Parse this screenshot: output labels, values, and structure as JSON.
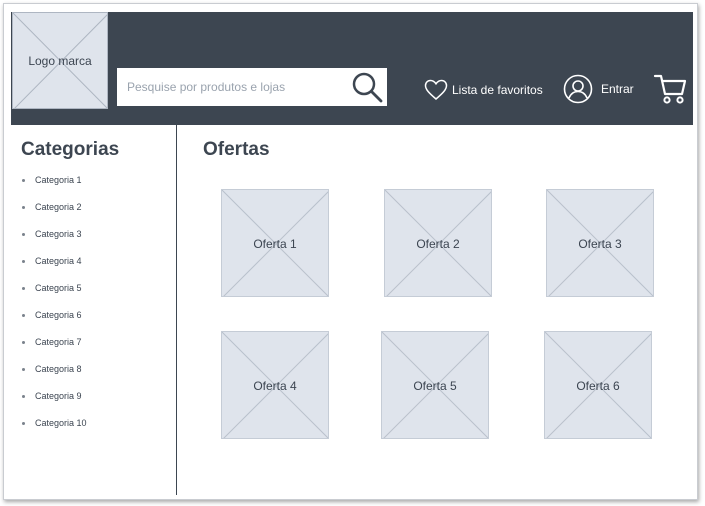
{
  "header": {
    "logo_label": "Logo marca",
    "search_placeholder": "Pesquise por produtos e lojas",
    "favorites_label": "Lista de favoritos",
    "login_label": "Entrar"
  },
  "sidebar": {
    "title": "Categorias",
    "items": [
      "Categoria 1",
      "Categoria 2",
      "Categoria 3",
      "Categoria 4",
      "Categoria 5",
      "Categoria 6",
      "Categoria 7",
      "Categoria 8",
      "Categoria 9",
      "Categoria 10"
    ]
  },
  "main": {
    "title": "Ofertas",
    "offers": [
      "Oferta 1",
      "Oferta 2",
      "Oferta 3",
      "Oferta 4",
      "Oferta 5",
      "Oferta 6"
    ]
  },
  "colors": {
    "header_bg": "#3d4651",
    "placeholder_fill": "#dfe4ec",
    "text": "#3c4551"
  },
  "icons": [
    "search-icon",
    "heart-icon",
    "user-icon",
    "cart-icon"
  ]
}
